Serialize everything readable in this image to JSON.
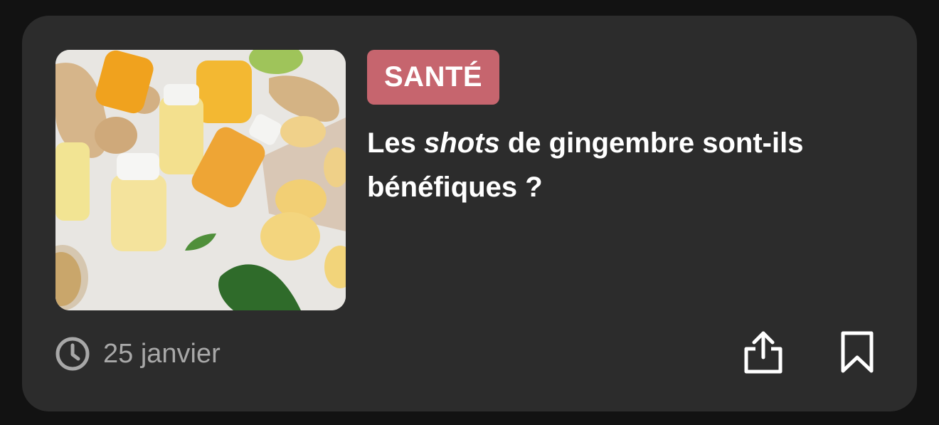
{
  "article": {
    "category": "SANTÉ",
    "title_before": "Les ",
    "title_italic": "shots",
    "title_after": " de gingembre sont-ils bénéfiques ?",
    "date": "25 janvier"
  },
  "icons": {
    "clock": "clock-icon",
    "share": "share-icon",
    "bookmark": "bookmark-icon"
  },
  "colors": {
    "card_background": "#2c2c2c",
    "page_background": "#121212",
    "badge_background": "#c6656e",
    "title_text": "#ffffff",
    "meta_text": "#a8a8a8"
  }
}
